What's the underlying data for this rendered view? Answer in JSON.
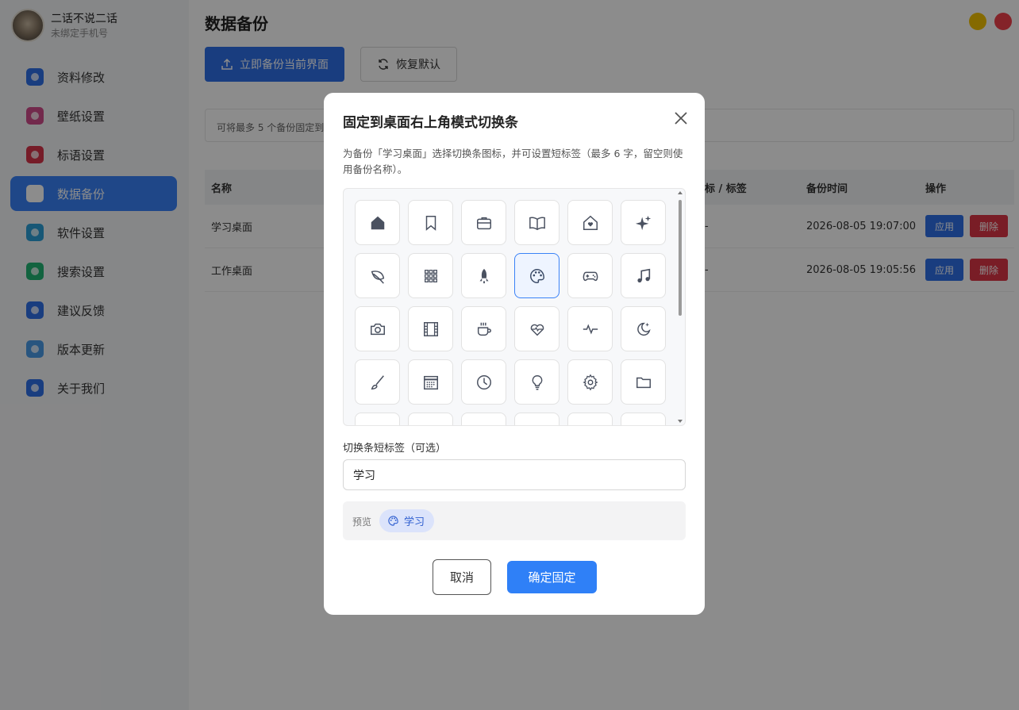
{
  "profile": {
    "name": "二话不说二话",
    "subtitle": "未绑定手机号"
  },
  "sidebar": {
    "items": [
      {
        "label": "资料修改",
        "icon": "user-edit-icon",
        "color": "#2f6fe8"
      },
      {
        "label": "壁纸设置",
        "icon": "wallpaper-icon",
        "color": "#d04b8a"
      },
      {
        "label": "标语设置",
        "icon": "quote-icon",
        "color": "#d8344a"
      },
      {
        "label": "数据备份",
        "icon": "cloud-backup-icon",
        "color": "#3a82f7",
        "active": true
      },
      {
        "label": "软件设置",
        "icon": "display-settings-icon",
        "color": "#2a9fd8"
      },
      {
        "label": "搜索设置",
        "icon": "search-settings-icon",
        "color": "#22b573"
      },
      {
        "label": "建议反馈",
        "icon": "feedback-icon",
        "color": "#2f6fe8"
      },
      {
        "label": "版本更新",
        "icon": "update-icon",
        "color": "#4a9be8"
      },
      {
        "label": "关于我们",
        "icon": "info-icon",
        "color": "#2f6fe8"
      }
    ]
  },
  "main": {
    "title": "数据备份",
    "backup_button": "立即备份当前界面",
    "restore_button": "恢复默认",
    "notice": "可将最多 5 个备份固定到",
    "table": {
      "headers": [
        "名称",
        "标 / 标签",
        "备份时间",
        "操作"
      ],
      "rows": [
        {
          "name": "学习桌面",
          "tag": "-",
          "time": "2026-08-05 19:07:00",
          "apply": "应用",
          "delete": "删除"
        },
        {
          "name": "工作桌面",
          "tag": "-",
          "time": "2026-08-05 19:05:56",
          "apply": "应用",
          "delete": "删除"
        }
      ]
    }
  },
  "modal": {
    "title": "固定到桌面右上角模式切换条",
    "description": "为备份「学习桌面」选择切换条图标，并可设置短标签（最多 6 字，留空则使用备份名称）。",
    "icons": [
      "home-icon",
      "bookmark-icon",
      "briefcase-icon",
      "book-icon",
      "house-heart-icon",
      "sparkles-icon",
      "leaf-icon",
      "grid-icon",
      "rocket-icon",
      "palette-icon",
      "gamepad-icon",
      "music-icon",
      "camera-icon",
      "film-icon",
      "coffee-icon",
      "heart-pulse-icon",
      "activity-icon",
      "moon-stars-icon",
      "brush-icon",
      "calendar-icon",
      "clock-icon",
      "lightbulb-icon",
      "gear-icon",
      "folder-icon"
    ],
    "selected_icon": "palette-icon",
    "field_label": "切换条短标签（可选）",
    "field_value": "学习",
    "preview_label": "预览",
    "preview_chip": "学习",
    "cancel_button": "取消",
    "confirm_button": "确定固定"
  },
  "window_controls": {
    "maximize_color": "#f2c200",
    "close_color": "#f0414b"
  }
}
